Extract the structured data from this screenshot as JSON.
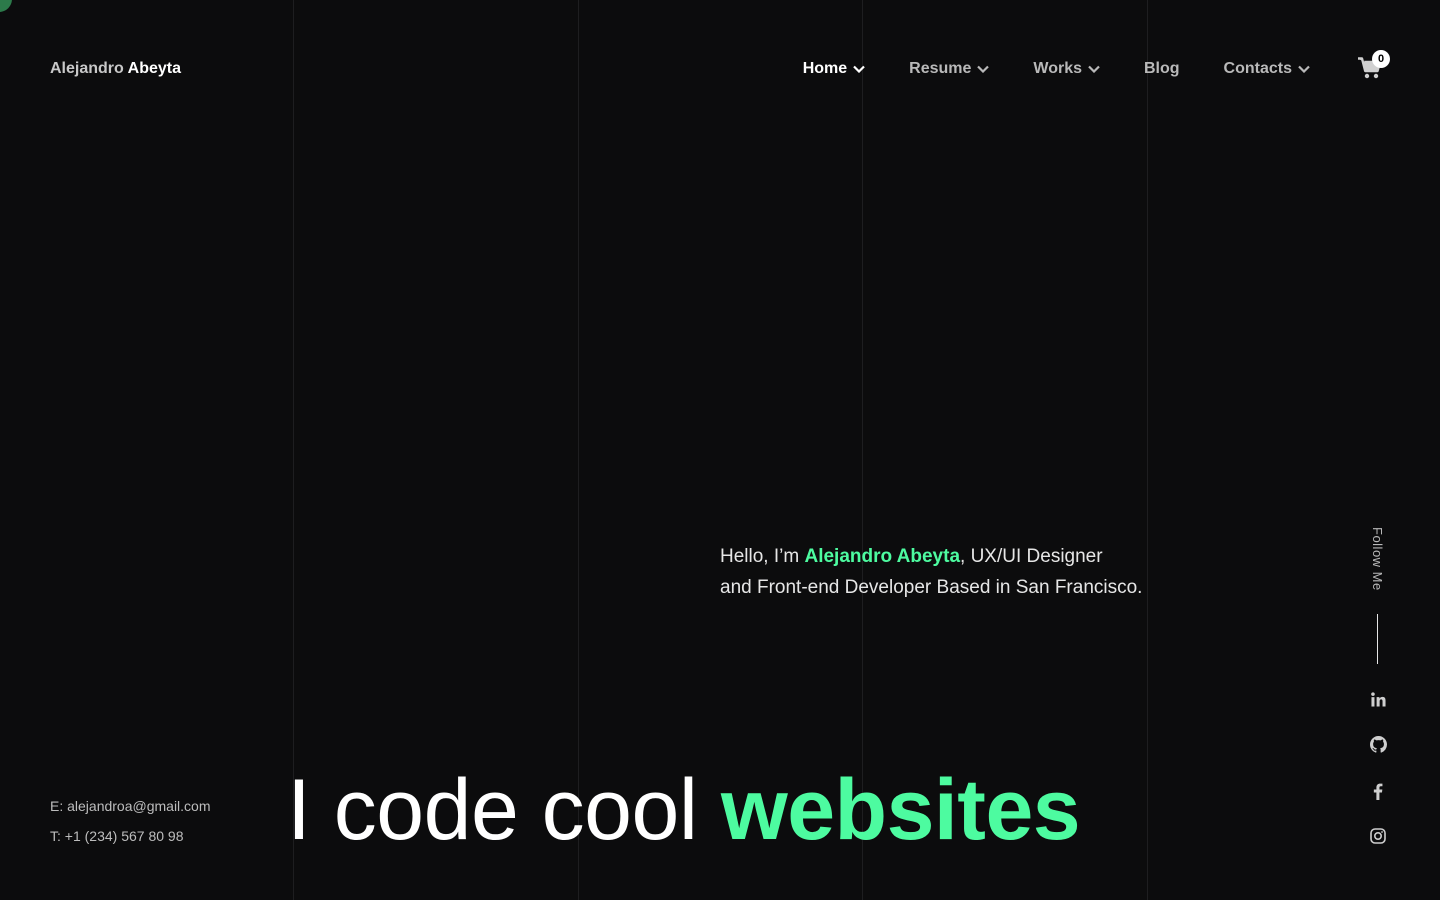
{
  "brand": {
    "first": "Alejandro",
    "last": "Abeyta"
  },
  "nav": {
    "items": [
      {
        "label": "Home",
        "active": true,
        "dropdown": true
      },
      {
        "label": "Resume",
        "active": false,
        "dropdown": true
      },
      {
        "label": "Works",
        "active": false,
        "dropdown": true
      },
      {
        "label": "Blog",
        "active": false,
        "dropdown": false
      },
      {
        "label": "Contacts",
        "active": false,
        "dropdown": true
      }
    ],
    "cart_count": "0"
  },
  "intro": {
    "greeting": "Hello, I’m ",
    "name": "Alejandro Abeyta",
    "rest_line1": ", UX/UI Designer",
    "line2": "and Front-end Developer Based in San Francisco."
  },
  "headline": {
    "text": "I code cool ",
    "accent": "websites"
  },
  "contact": {
    "email": "E: alejandroa@gmail.com",
    "phone": "T: +1 (234) 567 80 98"
  },
  "follow": {
    "label": "Follow Me",
    "icons": [
      "linkedin-icon",
      "github-icon",
      "facebook-icon",
      "instagram-icon"
    ]
  },
  "colors": {
    "accent": "#4dfba0",
    "background": "#0c0c0d"
  }
}
